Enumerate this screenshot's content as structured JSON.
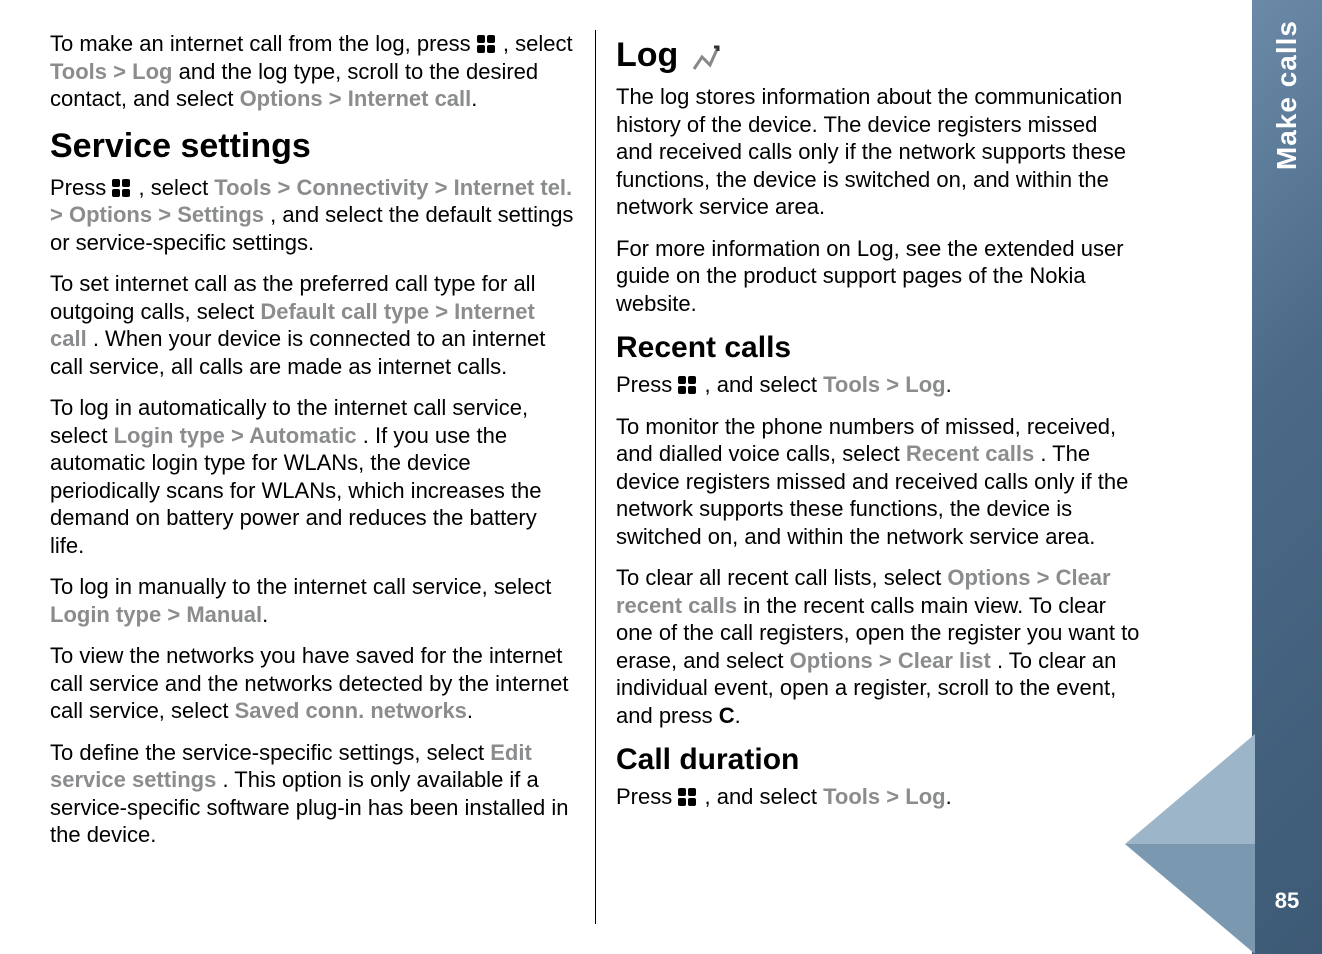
{
  "sideTab": {
    "label": "Make calls",
    "pageNumber": "85"
  },
  "left": {
    "p1_a": "To make an internet call from the log, press ",
    "p1_b": " , select ",
    "p1_tools": "Tools",
    "p1_log": "Log",
    "p1_c": " and the log type, scroll to the desired contact, and select ",
    "p1_options": "Options",
    "p1_internet_call": "Internet call",
    "h_service": "Service settings",
    "p2_a": "Press ",
    "p2_b": " , select ",
    "p2_tools": "Tools",
    "p2_connectivity": "Connectivity",
    "p2_internet_tel": "Internet tel.",
    "p2_options": "Options",
    "p2_settings": "Settings",
    "p2_c": ", and select the default settings or service-specific settings.",
    "p3_a": "To set internet call as the preferred call type for all outgoing calls, select ",
    "p3_default": "Default call type",
    "p3_internet_call": "Internet call",
    "p3_b": ". When your device is connected to an internet call service, all calls are made as internet calls.",
    "p4_a": "To log in automatically to the internet call service, select ",
    "p4_login": "Login type",
    "p4_auto": "Automatic",
    "p4_b": ". If you use the automatic login type for WLANs, the device periodically scans for WLANs, which increases the demand on battery power and reduces the battery life.",
    "p5_a": "To log in manually to the internet call service, select ",
    "p5_login": "Login type",
    "p5_manual": "Manual",
    "p6_a": "To view the networks you have saved for the internet call service and the networks detected by the internet call service, select ",
    "p6_saved": "Saved conn. networks",
    "p7_a": "To define the service-specific settings, select ",
    "p7_edit": "Edit service settings",
    "p7_b": ". This option is only available if a service-specific software plug-in has been installed in the device."
  },
  "right": {
    "h_log": "Log",
    "p1": "The log stores information about the communication history of the device. The device registers missed and received calls only if the network supports these functions, the device is switched on, and within the network service area.",
    "p2": "For more information on Log, see the extended user guide on the product support pages of the Nokia website.",
    "h_recent": "Recent calls",
    "p3_a": "Press ",
    "p3_b": " , and select ",
    "p3_tools": "Tools",
    "p3_log": "Log",
    "p4_a": "To monitor the phone numbers of missed, received, and dialled voice calls, select ",
    "p4_recent": "Recent calls",
    "p4_b": ". The device registers missed and received calls only if the network supports these functions, the device is switched on, and within the network service area.",
    "p5_a": "To clear all recent call lists, select ",
    "p5_options1": "Options",
    "p5_clear_recent": "Clear recent calls",
    "p5_b": " in the recent calls main view. To clear one of the call registers, open the register you want to erase, and select ",
    "p5_options2": "Options",
    "p5_clear_list": "Clear list",
    "p5_c": ". To clear an individual event, open a register, scroll to the event, and press ",
    "p5_key": "C",
    "h_duration": "Call duration",
    "p6_a": "Press ",
    "p6_b": " , and select ",
    "p6_tools": "Tools",
    "p6_log": "Log"
  },
  "sep": ">"
}
